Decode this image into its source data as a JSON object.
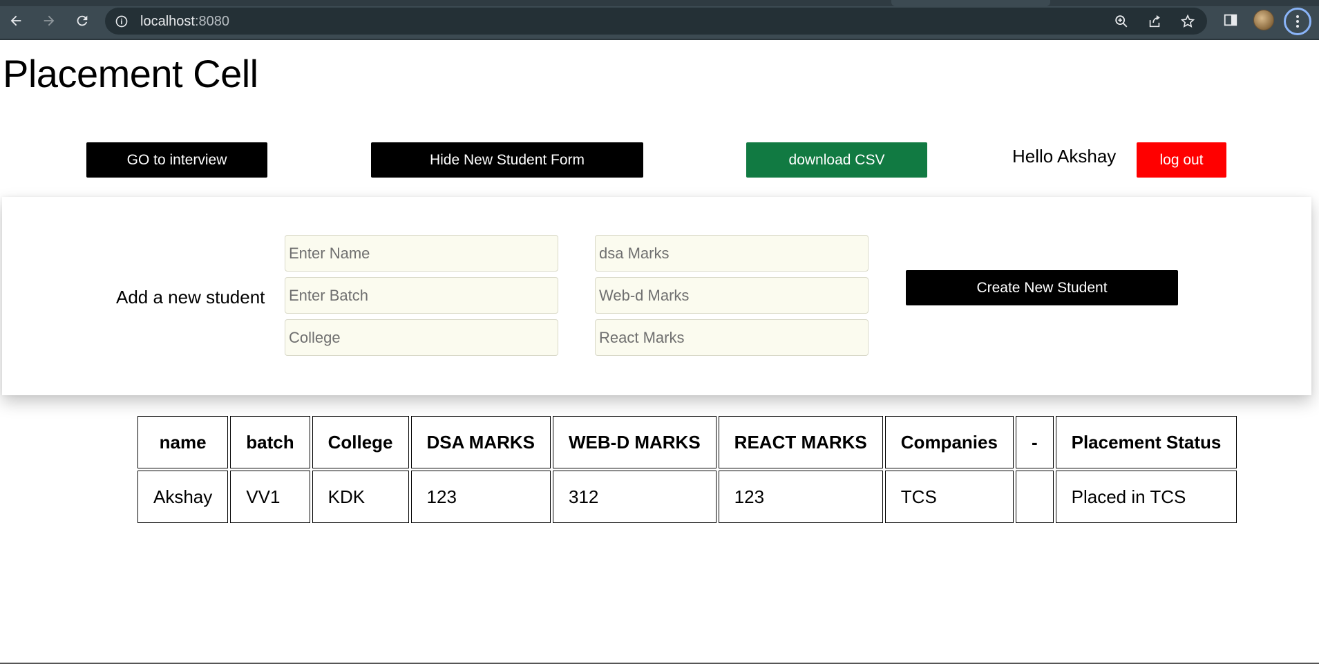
{
  "browser": {
    "url_host": "localhost",
    "url_port": ":8080",
    "icons": {
      "back": "arrow-left-icon",
      "forward": "arrow-right-icon",
      "reload": "reload-icon",
      "info": "info-icon",
      "zoom": "zoom-icon",
      "share": "share-icon",
      "bookmark": "star-icon",
      "side_panel": "side-panel-icon",
      "profile": "avatar",
      "menu": "kebab-menu-icon"
    }
  },
  "page": {
    "title": "Placement Cell"
  },
  "toolbar": {
    "go_interview_label": "GO to interview",
    "hide_form_label": "Hide New Student Form",
    "download_csv_label": "download CSV",
    "greeting": "Hello Akshay",
    "logout_label": "log out"
  },
  "colors": {
    "primary_button": "#000000",
    "download_button": "#117a42",
    "logout_button": "#ff0000",
    "input_background": "#fbfbef"
  },
  "form": {
    "label": "Add a new student",
    "name_placeholder": "Enter Name",
    "batch_placeholder": "Enter Batch",
    "college_placeholder": "College",
    "dsa_placeholder": "dsa Marks",
    "webd_placeholder": "Web-d Marks",
    "react_placeholder": "React Marks",
    "submit_label": "Create New Student"
  },
  "table": {
    "headers": [
      "name",
      "batch",
      "College",
      "DSA MARKS",
      "WEB-D MARKS",
      "REACT MARKS",
      "Companies",
      "-",
      "Placement Status"
    ],
    "rows": [
      [
        "Akshay",
        "VV1",
        "KDK",
        "123",
        "312",
        "123",
        "TCS",
        "",
        "Placed in TCS"
      ]
    ]
  }
}
